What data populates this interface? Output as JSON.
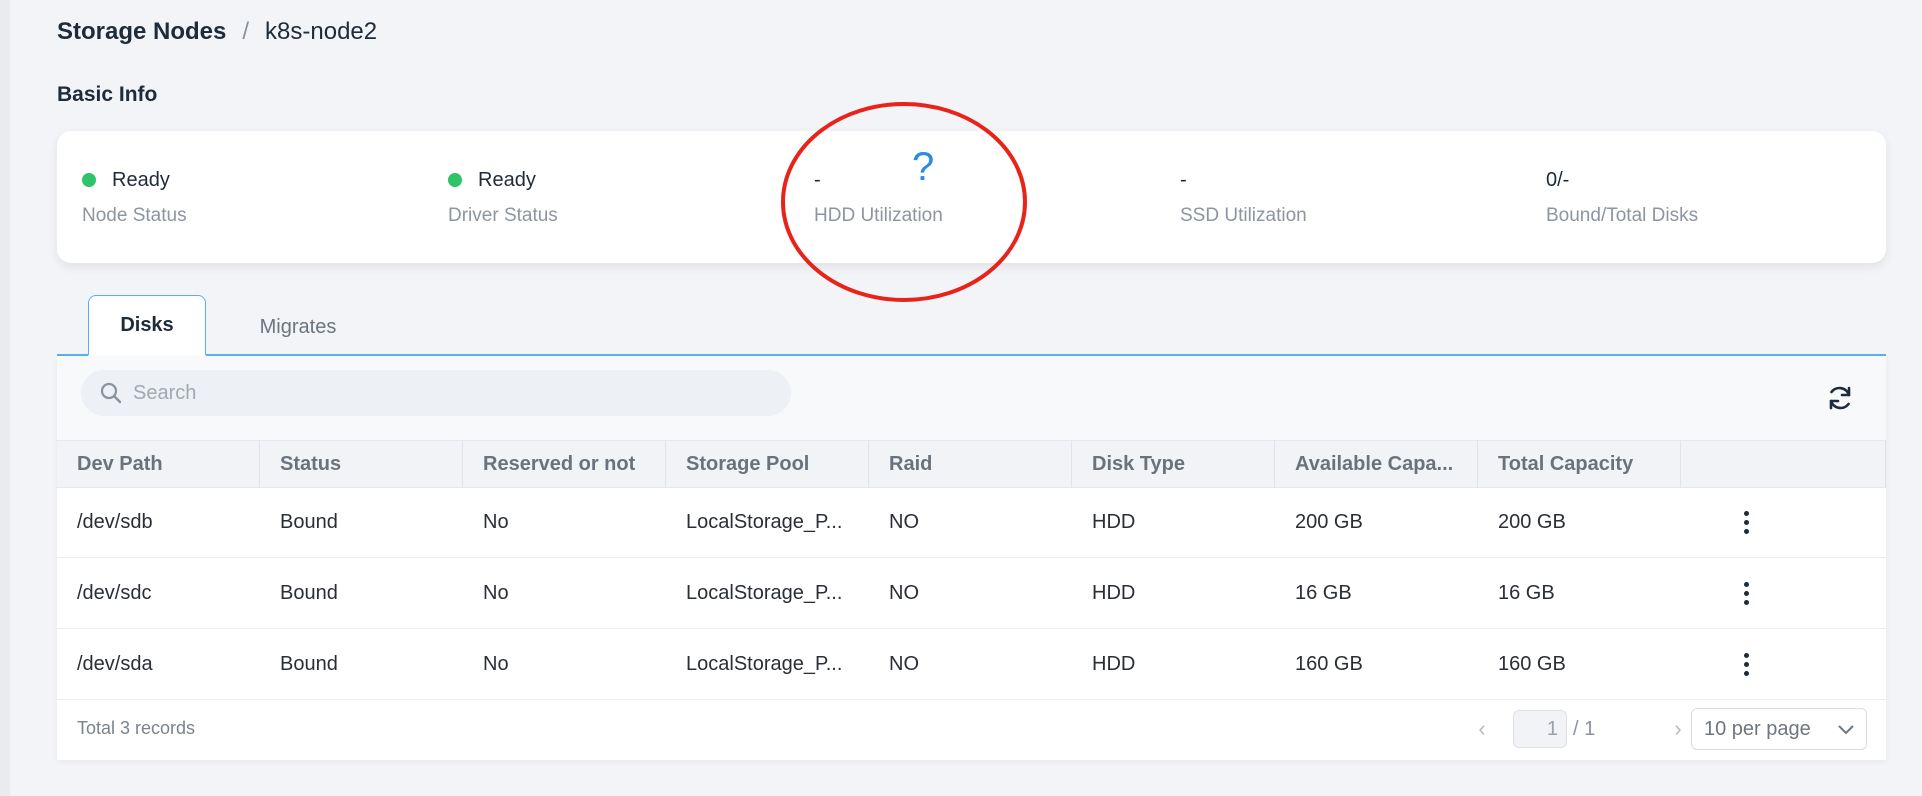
{
  "breadcrumb": {
    "root": "Storage Nodes",
    "separator": "/",
    "current": "k8s-node2"
  },
  "section_title": "Basic Info",
  "info": [
    {
      "value": "Ready",
      "label": "Node Status",
      "status_color": "#2fc36a"
    },
    {
      "value": "Ready",
      "label": "Driver Status",
      "status_color": "#2fc36a"
    },
    {
      "value": "-",
      "label": "HDD Utilization"
    },
    {
      "value": "-",
      "label": "SSD Utilization"
    },
    {
      "value": "0/-",
      "label": "Bound/Total Disks"
    }
  ],
  "annotation": {
    "help_mark": "?",
    "ellipse_color": "#e8231a",
    "help_color": "#2a8ae8"
  },
  "tabs": [
    {
      "label": "Disks",
      "active": true
    },
    {
      "label": "Migrates",
      "active": false
    }
  ],
  "search": {
    "placeholder": "Search",
    "value": ""
  },
  "icons": {
    "search": "search-icon",
    "refresh": "refresh-icon",
    "row_menu": "more-vertical-icon",
    "prev": "chevron-left-icon",
    "next": "chevron-right-icon",
    "dropdown": "chevron-down-icon"
  },
  "table": {
    "columns": [
      "Dev Path",
      "Status",
      "Reserved or not",
      "Storage Pool",
      "Raid",
      "Disk Type",
      "Available Capa...",
      "Total Capacity"
    ],
    "rows": [
      [
        "/dev/sdb",
        "Bound",
        "No",
        "LocalStorage_P...",
        "NO",
        "HDD",
        "200 GB",
        "200 GB"
      ],
      [
        "/dev/sdc",
        "Bound",
        "No",
        "LocalStorage_P...",
        "NO",
        "HDD",
        "16 GB",
        "16 GB"
      ],
      [
        "/dev/sda",
        "Bound",
        "No",
        "LocalStorage_P...",
        "NO",
        "HDD",
        "160 GB",
        "160 GB"
      ]
    ]
  },
  "footer": {
    "total": "Total 3 records",
    "current_page": "1",
    "page_total": "/ 1",
    "per_page": "10 per page"
  },
  "colors": {
    "accent": "#5ab0e8",
    "ready": "#2fc36a"
  }
}
